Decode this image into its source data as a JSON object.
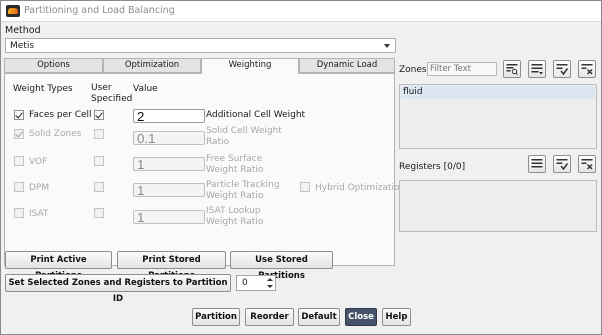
{
  "window": {
    "title": "Partitioning and Load Balancing"
  },
  "method": {
    "label": "Method",
    "selected": "Metis"
  },
  "tabs": [
    {
      "label": "Options",
      "active": false
    },
    {
      "label": "Optimization",
      "active": false
    },
    {
      "label": "Weighting",
      "active": true
    },
    {
      "label": "Dynamic Load Balancing",
      "active": false
    }
  ],
  "weighting": {
    "headers": {
      "types": "Weight Types",
      "user": "User\nSpecified",
      "value": "Value"
    },
    "rows": [
      {
        "type": "Faces per Cell",
        "type_checked": true,
        "type_enabled": true,
        "user_checked": true,
        "user_enabled": true,
        "value": "2",
        "value_enabled": true,
        "desc": "Additional Cell Weight"
      },
      {
        "type": "Solid Zones",
        "type_checked": true,
        "type_enabled": false,
        "user_checked": false,
        "user_enabled": false,
        "value": "0.1",
        "value_enabled": false,
        "desc": "Solid Cell Weight\nRatio"
      },
      {
        "type": "VOF",
        "type_checked": false,
        "type_enabled": false,
        "user_checked": false,
        "user_enabled": false,
        "value": "1",
        "value_enabled": false,
        "desc": "Free Surface\nWeight Ratio"
      },
      {
        "type": "DPM",
        "type_checked": false,
        "type_enabled": false,
        "user_checked": false,
        "user_enabled": false,
        "value": "1",
        "value_enabled": false,
        "desc": "Particle Tracking\nWeight Ratio"
      },
      {
        "type": "ISAT",
        "type_checked": false,
        "type_enabled": false,
        "user_checked": false,
        "user_enabled": false,
        "value": "1",
        "value_enabled": false,
        "desc": "ISAT Lookup\nWeight Ratio"
      }
    ],
    "hybrid": {
      "label": "Hybrid Optimization",
      "checked": false,
      "enabled": false
    }
  },
  "zones": {
    "label": "Zones",
    "filter_placeholder": "Filter Text",
    "items": [
      "fluid"
    ],
    "icons": [
      "filter-icon",
      "select-all-icon",
      "select-checked-icon",
      "deselect-all-icon"
    ]
  },
  "registers": {
    "label": "Registers [0/0]",
    "icons": [
      "select-all-icon",
      "select-checked-icon",
      "deselect-all-icon"
    ]
  },
  "actions": {
    "print_active": "Print Active Partitions",
    "print_stored": "Print Stored Partitions",
    "use_stored": "Use Stored Partitions",
    "set_selected": "Set Selected Zones and Registers to Partition ID",
    "partition_id": "0"
  },
  "footer": {
    "partition": "Partition",
    "reorder": "Reorder",
    "default": "Default",
    "close": "Close",
    "help": "Help"
  },
  "colors": {
    "primary_button": "#45546a",
    "list_selection": "#dde7f3"
  }
}
